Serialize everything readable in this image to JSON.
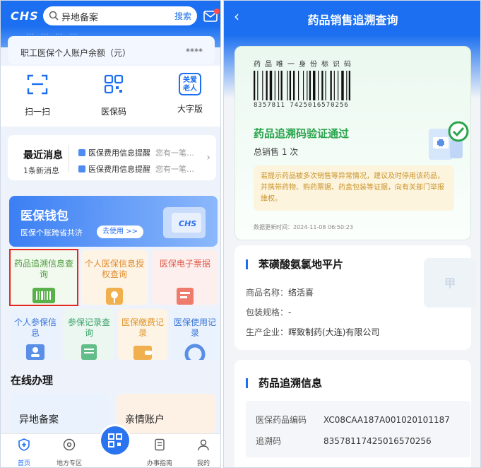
{
  "left": {
    "header": {
      "logo": "CHS",
      "search_placeholder": "异地备案",
      "search_button": "搜索"
    },
    "account": {
      "label": "职工医保个人账户余额（元）",
      "value": "****",
      "cut_text": "…  …  …  …"
    },
    "quick_actions": [
      {
        "label": "扫一扫",
        "icon": "scan-icon"
      },
      {
        "label": "医保码",
        "icon": "qr-code-icon"
      },
      {
        "label": "大字版",
        "icon": "elder-care-icon",
        "icon_text": "关爱老人"
      }
    ],
    "news": {
      "title": "最近消息",
      "count": "1条新消息",
      "items": [
        {
          "label": "医保费用信息提醒",
          "preview": "您有一笔…"
        },
        {
          "label": "医保费用信息提醒",
          "preview": "您有一笔…"
        }
      ]
    },
    "wallet": {
      "title": "医保钱包",
      "subtitle": "医保个账跨省共济",
      "button": "去使用 >>",
      "logo": "CHS"
    },
    "services": [
      {
        "label": "药品追溯信息查询",
        "color": "#4a9a3a"
      },
      {
        "label": "个人医保信息授权查询",
        "color": "#e08a2c"
      },
      {
        "label": "医保电子票据",
        "color": "#e05a4a"
      },
      {
        "label": "个人参保信息",
        "color": "#3a74d8"
      },
      {
        "label": "参保记录查询",
        "color": "#3aa36a"
      },
      {
        "label": "医保缴费记录",
        "color": "#e0962c"
      },
      {
        "label": "医保使用记录",
        "color": "#3a74d8"
      }
    ],
    "online": {
      "title": "在线办理",
      "cards": [
        "异地备案",
        "亲情账户"
      ]
    },
    "tabbar": [
      {
        "label": "首页",
        "icon": "home-shield-icon"
      },
      {
        "label": "地方专区",
        "icon": "local-zone-icon"
      },
      {
        "label": "办事指南",
        "icon": "guide-icon"
      },
      {
        "label": "我的",
        "icon": "profile-icon"
      }
    ]
  },
  "right": {
    "header": {
      "title": "药品销售追溯查询"
    },
    "barcode": {
      "title": "药品唯一身份标识码",
      "number": "8357811  7425016570256"
    },
    "verify": {
      "status": "药品追溯码验证通过",
      "sales": "总销售 1 次"
    },
    "warning": "若提示药品被多次销售等异常情况，建议及时停用该药品，并携带药物、购药票据、药盒包装等证据，向有关部门举报维权。",
    "updated": "数据更新时间：2024-11-08 06:50:23",
    "drug": {
      "name": "苯磺酸氨氯地平片",
      "fields": [
        {
          "key": "商品名称：",
          "value": "络活喜"
        },
        {
          "key": "包装规格：",
          "value": "-"
        },
        {
          "key": "生产企业：",
          "value": "晖致制药(大连)有限公司"
        }
      ],
      "image_char": "甲"
    },
    "trace": {
      "title": "药品追溯信息",
      "rows": [
        {
          "key": "医保药品编码",
          "value": "XC08CAA187A001020101187"
        },
        {
          "key": "追溯码",
          "value": "83578117425016570256"
        }
      ]
    }
  },
  "colors": {
    "primary": "#1b6ff0",
    "success": "#2aa44d",
    "warning_text": "#c9932a",
    "highlight": "#e8261c"
  }
}
